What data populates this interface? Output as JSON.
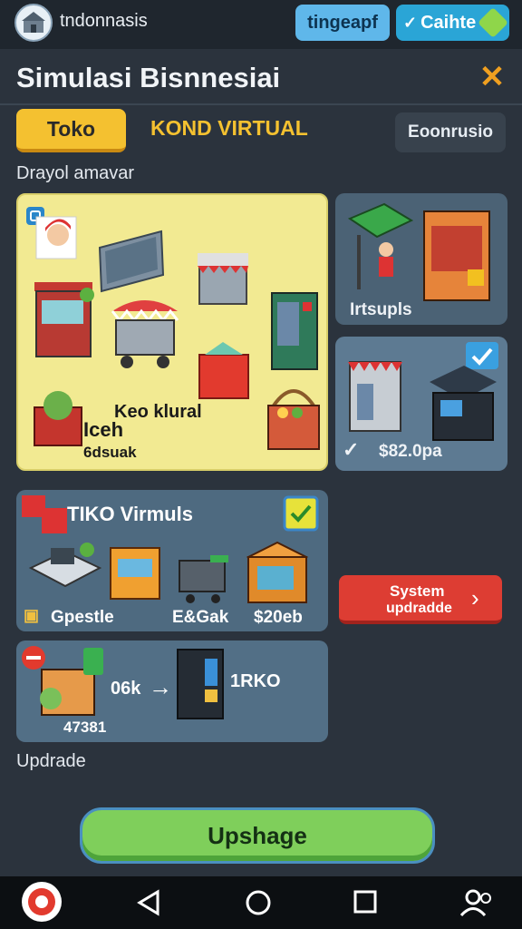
{
  "header": {
    "app_name": "tndonnasis",
    "pill_left": "tingeapf",
    "pill_right": "Caihte"
  },
  "page": {
    "title": "Simulasi Bisnnesiai",
    "close_symbol": "✕"
  },
  "tabs": {
    "toko": "Toko",
    "kond_virtual": "KOND VIRTUAL",
    "ekonomi_button": "Eoonrusio"
  },
  "section": {
    "subhead": "Drayol amavar"
  },
  "main_card": {
    "line1": "Keo klural",
    "line2": "Iceh",
    "line3": "6dsuak"
  },
  "side_cards": {
    "card1_label": "Irtsupls",
    "card2_price": "$82.0pa"
  },
  "mid_card": {
    "title": "TIKO Virmuls",
    "label1": "Gpestle",
    "label2": "E&Gak",
    "label3": "$20eb"
  },
  "low_card": {
    "value1": "06k",
    "value2": "1RKO",
    "value3": "47381"
  },
  "buttons": {
    "system_line1": "System",
    "system_line2": "updradde",
    "upshage": "Upshage"
  },
  "bottom": {
    "label": "Updrade"
  },
  "colors": {
    "accent_yellow": "#f4c130",
    "accent_red": "#dd3d33",
    "accent_green": "#7fcf5b",
    "pill_blue": "#2aa5d6"
  },
  "icons": [
    "store-logo-icon",
    "checkmark-tag-icon",
    "close-icon",
    "arrow-right-icon",
    "back-icon",
    "home-icon",
    "recents-icon",
    "account-icon",
    "app-badge-icon"
  ]
}
